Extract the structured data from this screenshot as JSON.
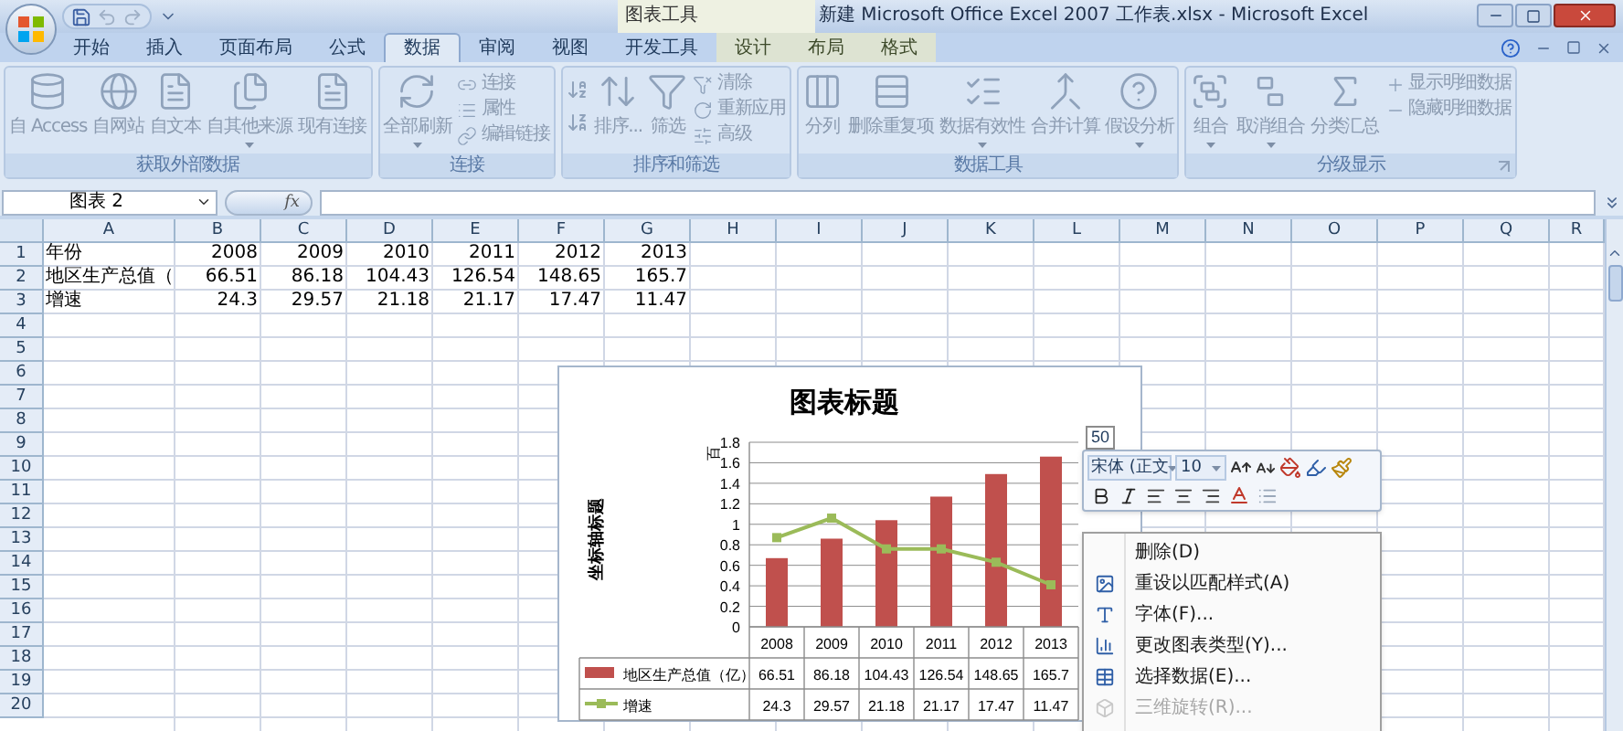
{
  "title_bar": {
    "contextual_label": "图表工具",
    "title": "新建 Microsoft Office Excel 2007 工作表.xlsx - Microsoft Excel"
  },
  "tabs": [
    {
      "label": "开始",
      "selected": false,
      "contextual": false
    },
    {
      "label": "插入",
      "selected": false,
      "contextual": false
    },
    {
      "label": "页面布局",
      "selected": false,
      "contextual": false
    },
    {
      "label": "公式",
      "selected": false,
      "contextual": false
    },
    {
      "label": "数据",
      "selected": true,
      "contextual": false
    },
    {
      "label": "审阅",
      "selected": false,
      "contextual": false
    },
    {
      "label": "视图",
      "selected": false,
      "contextual": false
    },
    {
      "label": "开发工具",
      "selected": false,
      "contextual": false
    },
    {
      "label": "设计",
      "selected": false,
      "contextual": true
    },
    {
      "label": "布局",
      "selected": false,
      "contextual": true
    },
    {
      "label": "格式",
      "selected": false,
      "contextual": true
    }
  ],
  "ribbon_groups": [
    {
      "label": "获取外部数据",
      "launcher": false,
      "items": [
        {
          "kind": "large",
          "label": "自 Access",
          "dropdown": false
        },
        {
          "kind": "large",
          "label": "自网站",
          "dropdown": false
        },
        {
          "kind": "large",
          "label": "自文本",
          "dropdown": false
        },
        {
          "kind": "large",
          "label": "自其他来源",
          "dropdown": true
        },
        {
          "kind": "large",
          "label": "现有连接",
          "dropdown": false
        }
      ]
    },
    {
      "label": "连接",
      "launcher": false,
      "items": [
        {
          "kind": "large",
          "label": "全部刷新",
          "dropdown": true
        },
        {
          "kind": "stack",
          "labels": [
            "连接",
            "属性",
            "编辑链接"
          ]
        }
      ]
    },
    {
      "label": "排序和筛选",
      "launcher": false,
      "items": [
        {
          "kind": "sort_icons"
        },
        {
          "kind": "large",
          "label": "排序...",
          "dropdown": false
        },
        {
          "kind": "large",
          "label": "筛选",
          "dropdown": false
        },
        {
          "kind": "stack",
          "labels": [
            "清除",
            "重新应用",
            "高级"
          ]
        }
      ]
    },
    {
      "label": "数据工具",
      "launcher": false,
      "items": [
        {
          "kind": "large",
          "label": "分列",
          "dropdown": false
        },
        {
          "kind": "large",
          "label": "删除重复项",
          "dropdown": false
        },
        {
          "kind": "large",
          "label": "数据有效性",
          "dropdown": true
        },
        {
          "kind": "large",
          "label": "合并计算",
          "dropdown": false
        },
        {
          "kind": "large",
          "label": "假设分析",
          "dropdown": true
        }
      ]
    },
    {
      "label": "分级显示",
      "launcher": true,
      "items": [
        {
          "kind": "large",
          "label": "组合",
          "dropdown": true
        },
        {
          "kind": "large",
          "label": "取消组合",
          "dropdown": true
        },
        {
          "kind": "large",
          "label": "分类汇总",
          "dropdown": false
        },
        {
          "kind": "stack",
          "labels": [
            "显示明细数据",
            "隐藏明细数据"
          ]
        }
      ]
    }
  ],
  "formula_bar": {
    "name_box": "图表 2",
    "fx": "fx"
  },
  "columns": [
    "A",
    "B",
    "C",
    "D",
    "E",
    "F",
    "G",
    "H",
    "I",
    "J",
    "K",
    "L",
    "M",
    "N",
    "O",
    "P",
    "Q",
    "R"
  ],
  "row_numbers": [
    "1",
    "2",
    "3",
    "4",
    "5",
    "6",
    "7",
    "8",
    "9",
    "10",
    "11",
    "12",
    "13",
    "14",
    "15",
    "16",
    "17",
    "18",
    "19",
    "20"
  ],
  "cells": [
    [
      "年份",
      "2008",
      "2009",
      "2010",
      "2011",
      "2012",
      "2013"
    ],
    [
      "地区生产总值（",
      "66.51",
      "86.18",
      "104.43",
      "126.54",
      "148.65",
      "165.7"
    ],
    [
      "增速",
      "24.3",
      "29.57",
      "21.18",
      "21.17",
      "17.47",
      "11.47"
    ]
  ],
  "chart": {
    "title": "图表标题",
    "y_axis_title": "坐标轴标题",
    "unit_label": "百",
    "secondary_axis_label": "50",
    "chart_data": {
      "type": "bar",
      "grid": true,
      "legend": true,
      "categories": [
        "2008",
        "2009",
        "2010",
        "2011",
        "2012",
        "2013"
      ],
      "ylim": [
        0,
        1.8
      ],
      "yticks": [
        0,
        0.2,
        0.4,
        0.6,
        0.8,
        1,
        1.2,
        1.4,
        1.6,
        1.8
      ],
      "series": [
        {
          "name": "地区生产总值（亿）",
          "type": "bar",
          "color": "#c0504d",
          "values": [
            0.67,
            0.86,
            1.04,
            1.27,
            1.49,
            1.66
          ]
        },
        {
          "name": "增速",
          "type": "line",
          "color": "#9bbb59",
          "marker": "square",
          "values": [
            0.87,
            1.06,
            0.76,
            0.76,
            0.63,
            0.41
          ]
        }
      ]
    },
    "data_table": [
      [
        "66.51",
        "86.18",
        "104.43",
        "126.54",
        "148.65",
        "165.7"
      ],
      [
        "24.3",
        "29.57",
        "21.18",
        "21.17",
        "17.47",
        "11.47"
      ]
    ]
  },
  "mini_toolbar": {
    "font": "宋体 (正文",
    "size": "10"
  },
  "context_menu": [
    {
      "label": "删除(D)",
      "disabled": false
    },
    {
      "label": "重设以匹配样式(A)",
      "disabled": false
    },
    {
      "label": "字体(F)...",
      "disabled": false
    },
    {
      "label": "更改图表类型(Y)...",
      "disabled": false
    },
    {
      "label": "选择数据(E)...",
      "disabled": false
    },
    {
      "label": "三维旋转(R)...",
      "disabled": true
    }
  ]
}
